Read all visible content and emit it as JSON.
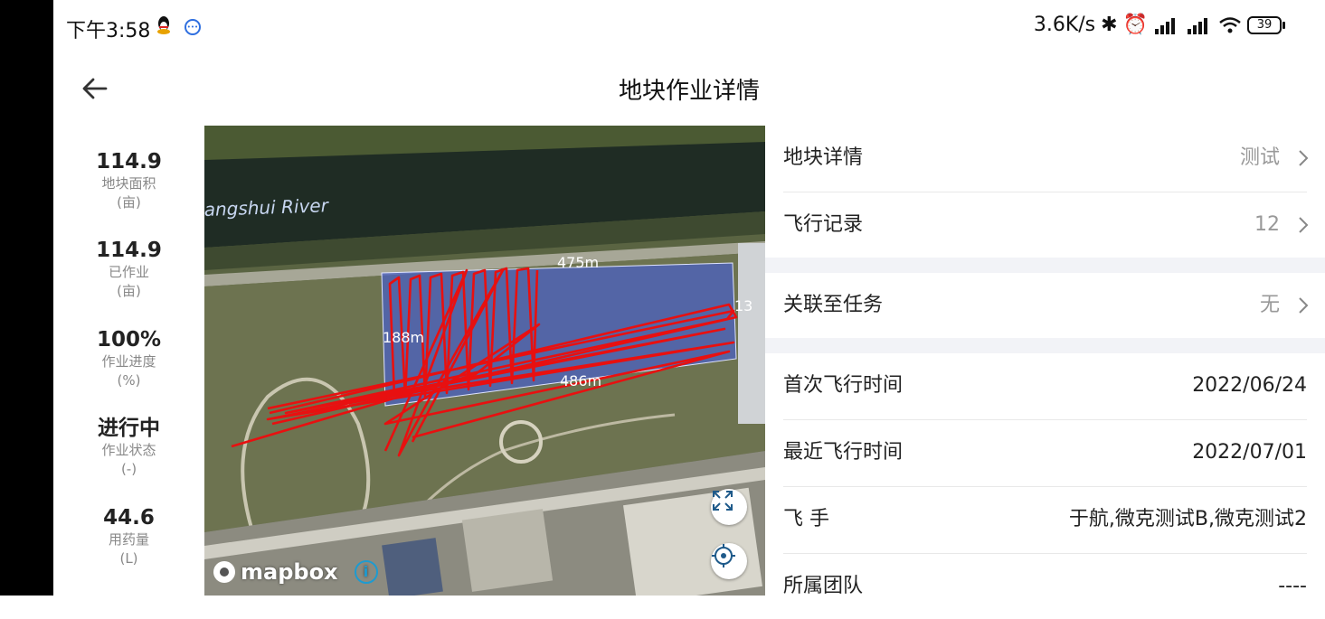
{
  "status_bar": {
    "time": "下午3:58",
    "net_speed": "3.6K/s",
    "battery": "39"
  },
  "header": {
    "title": "地块作业详情"
  },
  "stats": [
    {
      "value": "114.9",
      "label": "地块面积",
      "unit": "(亩)"
    },
    {
      "value": "114.9",
      "label": "已作业",
      "unit": "(亩)"
    },
    {
      "value": "100%",
      "label": "作业进度",
      "unit": "(%)"
    },
    {
      "value": "进行中",
      "label": "作业状态",
      "unit": "(-)"
    },
    {
      "value": "44.6",
      "label": "用药量",
      "unit": "(L)"
    }
  ],
  "map": {
    "river_label": "angshui River",
    "dim_top": "475m",
    "dim_bottom": "486m",
    "dim_left": "188m",
    "dim_right": "13",
    "attribution": "mapbox",
    "info": "i"
  },
  "details": {
    "plot_details": {
      "label": "地块详情",
      "value": "测试"
    },
    "flight_records": {
      "label": "飞行记录",
      "value": "12"
    },
    "linked_task": {
      "label": "关联至任务",
      "value": "无"
    },
    "first_flight": {
      "label": "首次飞行时间",
      "value": "2022/06/24"
    },
    "latest_flight": {
      "label": "最近飞行时间",
      "value": "2022/07/01"
    },
    "pilots": {
      "label": "飞 手",
      "value": "于航,微克测试B,微克测试2"
    },
    "team": {
      "label": "所属团队",
      "value": "----"
    }
  },
  "colors": {
    "flight_path": "#e81010",
    "plot_fill": "#4a5fc8",
    "gap_bg": "#f2f3f7",
    "accent_info": "#1e9bd0"
  }
}
